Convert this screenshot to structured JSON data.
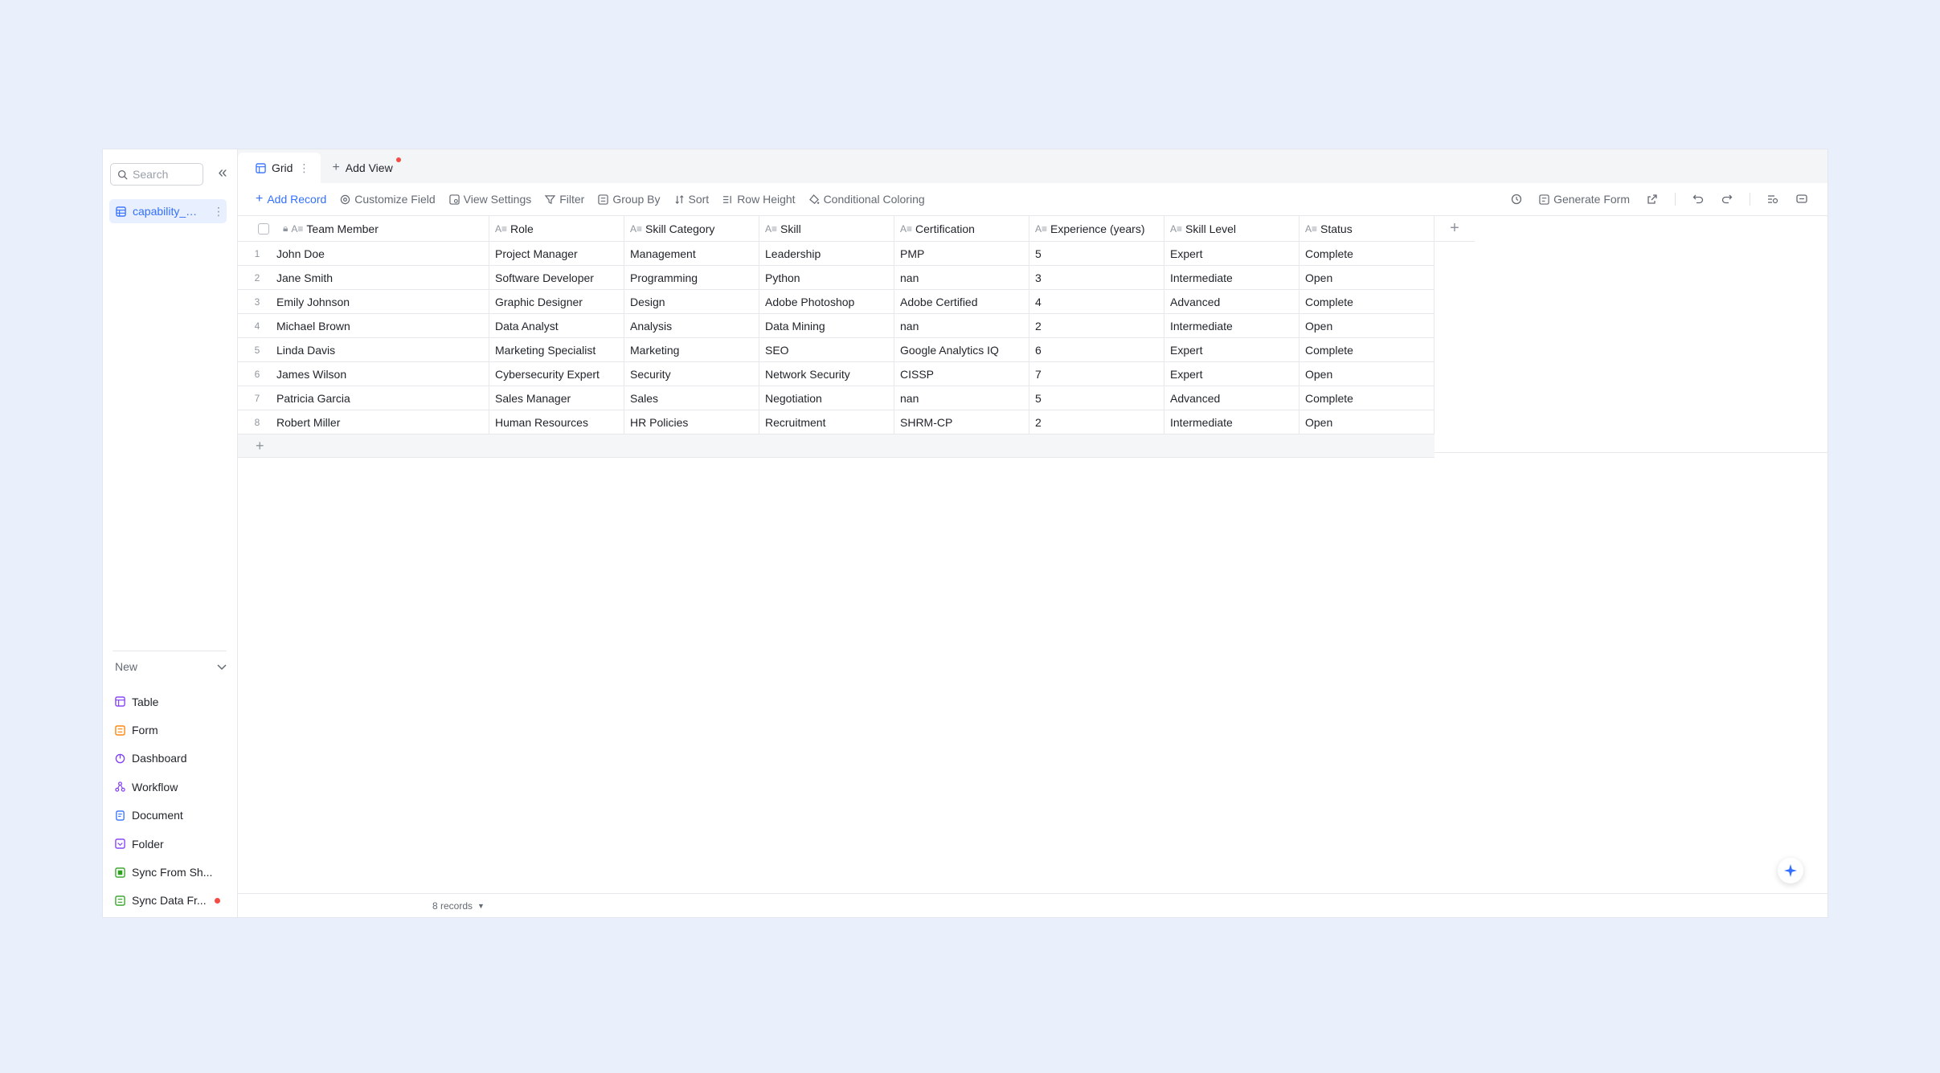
{
  "sidebar": {
    "search_placeholder": "Search",
    "table_name": "capability_ma...",
    "new_label": "New",
    "new_items": [
      {
        "label": "Table",
        "icon": "table-icon",
        "color": "#7f3bf5"
      },
      {
        "label": "Form",
        "icon": "form-icon",
        "color": "#ff7d00"
      },
      {
        "label": "Dashboard",
        "icon": "dashboard-icon",
        "color": "#7f3bf5"
      },
      {
        "label": "Workflow",
        "icon": "workflow-icon",
        "color": "#7f3bf5"
      },
      {
        "label": "Document",
        "icon": "document-icon",
        "color": "#3370ff"
      },
      {
        "label": "Folder",
        "icon": "folder-icon",
        "color": "#7f3bf5"
      },
      {
        "label": "Sync From Sh...",
        "icon": "sync-sheet-icon",
        "color": "#2ea121"
      },
      {
        "label": "Sync Data Fr...",
        "icon": "sync-data-icon",
        "color": "#2ea121"
      }
    ]
  },
  "tabs": {
    "grid_label": "Grid",
    "add_view_label": "Add View"
  },
  "toolbar": {
    "add_record": "Add Record",
    "customize_field": "Customize Field",
    "view_settings": "View Settings",
    "filter": "Filter",
    "group_by": "Group By",
    "sort": "Sort",
    "row_height": "Row Height",
    "conditional_coloring": "Conditional Coloring",
    "generate_form": "Generate Form"
  },
  "table": {
    "columns": [
      "Team Member",
      "Role",
      "Skill Category",
      "Skill",
      "Certification",
      "Experience (years)",
      "Skill Level",
      "Status"
    ],
    "rows": [
      {
        "idx": "1",
        "cells": [
          "John Doe",
          "Project Manager",
          "Management",
          "Leadership",
          "PMP",
          "5",
          "Expert",
          "Complete"
        ]
      },
      {
        "idx": "2",
        "cells": [
          "Jane Smith",
          "Software Developer",
          "Programming",
          "Python",
          "nan",
          "3",
          "Intermediate",
          "Open"
        ]
      },
      {
        "idx": "3",
        "cells": [
          "Emily Johnson",
          "Graphic Designer",
          "Design",
          "Adobe Photoshop",
          "Adobe Certified",
          "4",
          "Advanced",
          "Complete"
        ]
      },
      {
        "idx": "4",
        "cells": [
          "Michael Brown",
          "Data Analyst",
          "Analysis",
          "Data Mining",
          "nan",
          "2",
          "Intermediate",
          "Open"
        ]
      },
      {
        "idx": "5",
        "cells": [
          "Linda Davis",
          "Marketing Specialist",
          "Marketing",
          "SEO",
          "Google Analytics IQ",
          "6",
          "Expert",
          "Complete"
        ]
      },
      {
        "idx": "6",
        "cells": [
          "James Wilson",
          "Cybersecurity Expert",
          "Security",
          "Network Security",
          "CISSP",
          "7",
          "Expert",
          "Open"
        ]
      },
      {
        "idx": "7",
        "cells": [
          "Patricia Garcia",
          "Sales Manager",
          "Sales",
          "Negotiation",
          "nan",
          "5",
          "Advanced",
          "Complete"
        ]
      },
      {
        "idx": "8",
        "cells": [
          "Robert Miller",
          "Human Resources",
          "HR Policies",
          "Recruitment",
          "SHRM-CP",
          "2",
          "Intermediate",
          "Open"
        ]
      }
    ]
  },
  "footer": {
    "records": "8 records"
  },
  "colors": {
    "accent": "#3370ff",
    "page_bg": "#eaeffc",
    "alert_dot": "#f54a45"
  }
}
